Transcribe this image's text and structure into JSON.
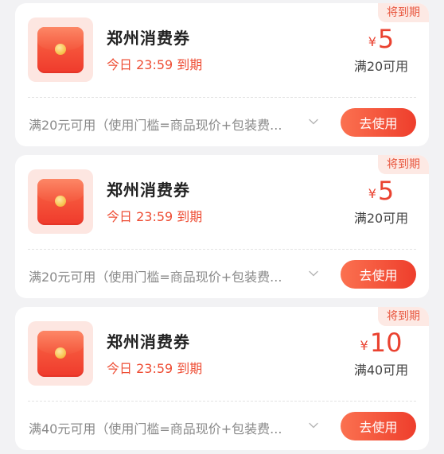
{
  "coupons": [
    {
      "badge": "将到期",
      "title": "郑州消费券",
      "expiry": "今日 23:59 到期",
      "currency": "¥",
      "amount": "5",
      "threshold": "满20可用",
      "rule": "满20元可用（使用门槛=商品现价+包装费...",
      "button": "去使用"
    },
    {
      "badge": "将到期",
      "title": "郑州消费券",
      "expiry": "今日 23:59 到期",
      "currency": "¥",
      "amount": "5",
      "threshold": "满20可用",
      "rule": "满20元可用（使用门槛=商品现价+包装费...",
      "button": "去使用"
    },
    {
      "badge": "将到期",
      "title": "郑州消费券",
      "expiry": "今日 23:59 到期",
      "currency": "¥",
      "amount": "10",
      "threshold": "满40可用",
      "rule": "满40元可用（使用门槛=商品现价+包装费...",
      "button": "去使用"
    }
  ],
  "icons": {
    "thumbnail": "red-envelope-icon",
    "expand": "chevron-down-icon"
  },
  "colors": {
    "accent": "#ee4d34",
    "badge_bg": "#fde9e4",
    "button_start": "#fb7150",
    "button_end": "#ee3e2c",
    "page_bg": "#f2f2f4"
  }
}
